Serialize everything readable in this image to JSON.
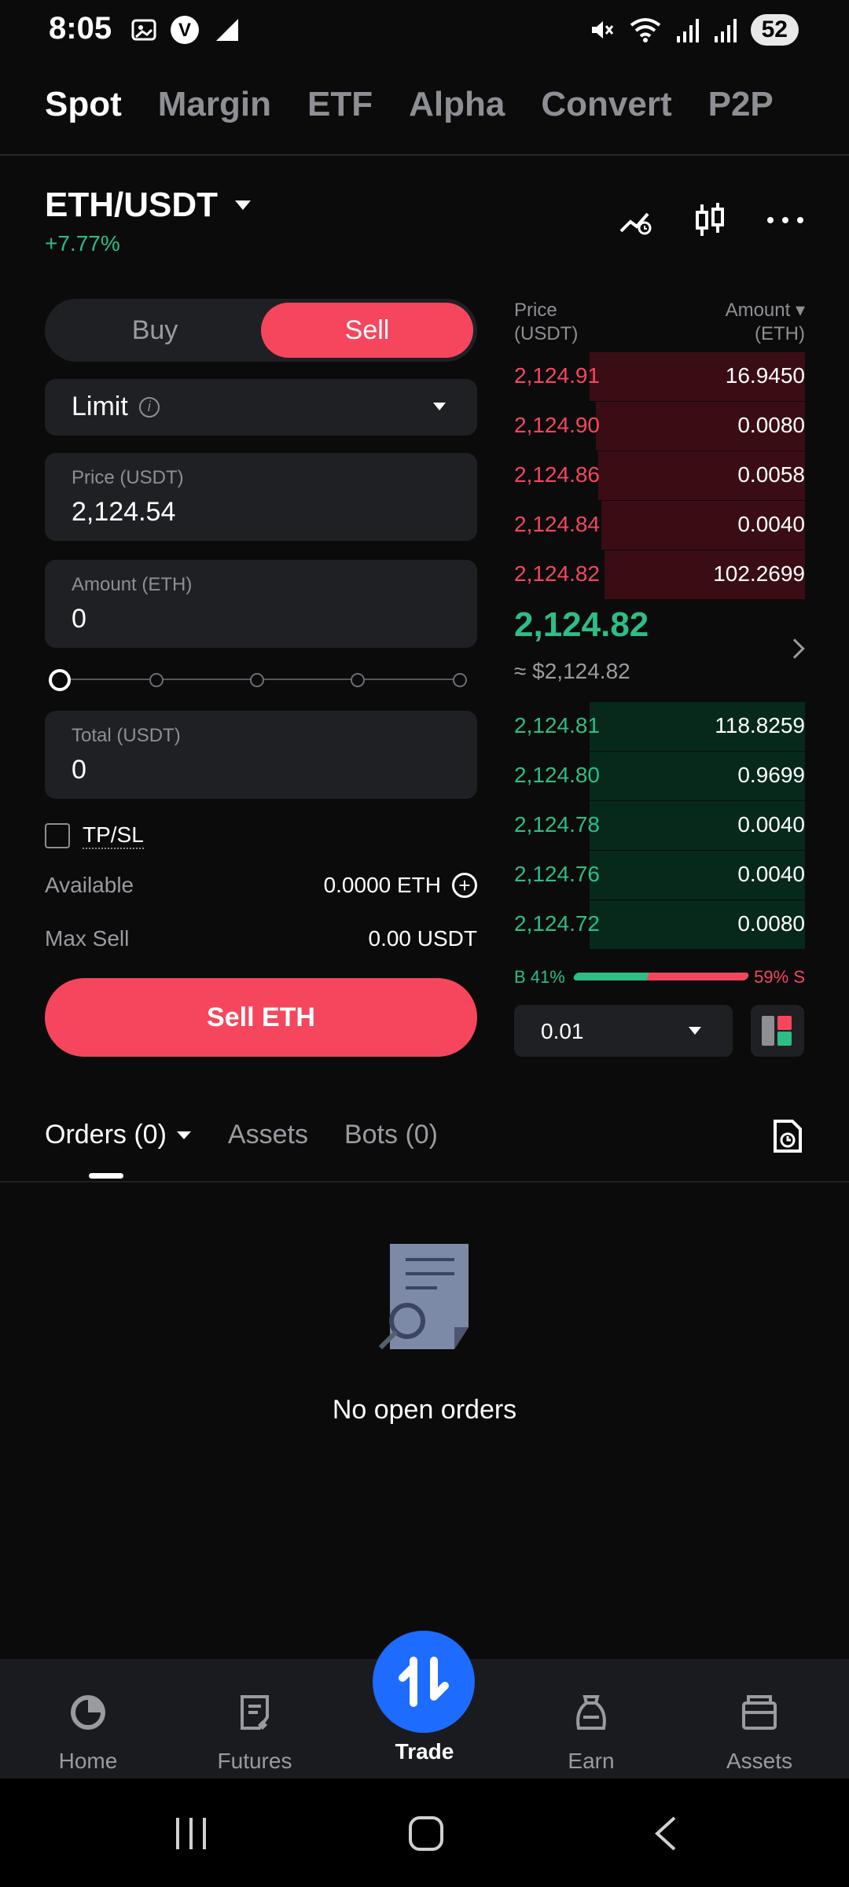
{
  "status_bar": {
    "time": "8:05",
    "battery": "52",
    "icons": [
      "gallery-icon",
      "v-badge-icon",
      "signal-boost-icon",
      "mute-icon",
      "wifi-icon",
      "signal-icon",
      "signal-icon-2"
    ]
  },
  "top_tabs": [
    {
      "label": "Spot",
      "active": true
    },
    {
      "label": "Margin",
      "active": false
    },
    {
      "label": "ETF",
      "active": false
    },
    {
      "label": "Alpha",
      "active": false
    },
    {
      "label": "Convert",
      "active": false
    },
    {
      "label": "P2P",
      "active": false
    }
  ],
  "pair": {
    "symbol": "ETH/USDT",
    "change": "+7.77%"
  },
  "order_form": {
    "buy_label": "Buy",
    "sell_label": "Sell",
    "order_type": "Limit",
    "price_label": "Price (USDT)",
    "price_value": "2,124.54",
    "amount_label": "Amount (ETH)",
    "amount_value": "0",
    "total_label": "Total (USDT)",
    "total_value": "0",
    "slider_percent": 0,
    "tpsl_label": "TP/SL",
    "available_label": "Available",
    "available_value": "0.0000 ETH",
    "max_sell_label": "Max Sell",
    "max_sell_value": "0.00 USDT",
    "submit_label": "Sell ETH"
  },
  "order_book": {
    "price_header_1": "Price",
    "price_header_2": "(USDT)",
    "amount_header_1": "Amount ▾",
    "amount_header_2": "(ETH)",
    "asks": [
      {
        "price": "2,124.91",
        "amount": "16.9450",
        "depth": 0.74
      },
      {
        "price": "2,124.90",
        "amount": "0.0080",
        "depth": 0.72
      },
      {
        "price": "2,124.86",
        "amount": "0.0058",
        "depth": 0.71
      },
      {
        "price": "2,124.84",
        "amount": "0.0040",
        "depth": 0.7
      },
      {
        "price": "2,124.82",
        "amount": "102.2699",
        "depth": 0.69
      }
    ],
    "mid_price": "2,124.82",
    "mid_usd": "≈ $2,124.82",
    "bids": [
      {
        "price": "2,124.81",
        "amount": "118.8259",
        "depth": 0.74
      },
      {
        "price": "2,124.80",
        "amount": "0.9699",
        "depth": 0.74
      },
      {
        "price": "2,124.78",
        "amount": "0.0040",
        "depth": 0.74
      },
      {
        "price": "2,124.76",
        "amount": "0.0040",
        "depth": 0.74
      },
      {
        "price": "2,124.72",
        "amount": "0.0080",
        "depth": 0.74
      }
    ],
    "buy_ratio": "B 41%",
    "sell_ratio": "59% S",
    "buy_ratio_value": 41,
    "sell_ratio_value": 59,
    "depth_value": "0.01"
  },
  "orders_tabs": {
    "orders": "Orders (0)",
    "assets": "Assets",
    "bots": "Bots (0)"
  },
  "empty_state": {
    "message": "No open orders"
  },
  "bottom_nav": {
    "home": "Home",
    "futures": "Futures",
    "trade": "Trade",
    "earn": "Earn",
    "assets": "Assets"
  },
  "colors": {
    "sell": "#f6465d",
    "buy": "#2ebd85",
    "accent": "#1e6bff",
    "background": "#0b0b0c"
  }
}
